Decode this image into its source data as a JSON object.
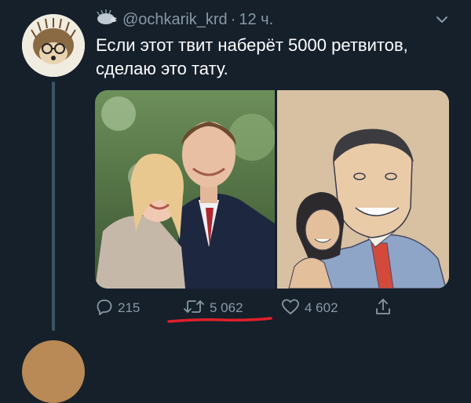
{
  "tweet": {
    "handle": "@ochkarik_krd",
    "separator": "·",
    "time": "12 ч.",
    "text_line1": "Если этот твит наберёт 5000 ретвитов,",
    "text_line2": "сделаю это тату.",
    "media": [
      {
        "kind": "photo",
        "icon": "photo-image"
      },
      {
        "kind": "drawing",
        "icon": "pencil-drawing-image"
      }
    ]
  },
  "actions": {
    "replies": "215",
    "retweets": "5 062",
    "likes": "4 602"
  },
  "colors": {
    "background": "#15202b",
    "muted": "#8899a6",
    "text": "#ffffff",
    "annotation": "#e0202a"
  }
}
